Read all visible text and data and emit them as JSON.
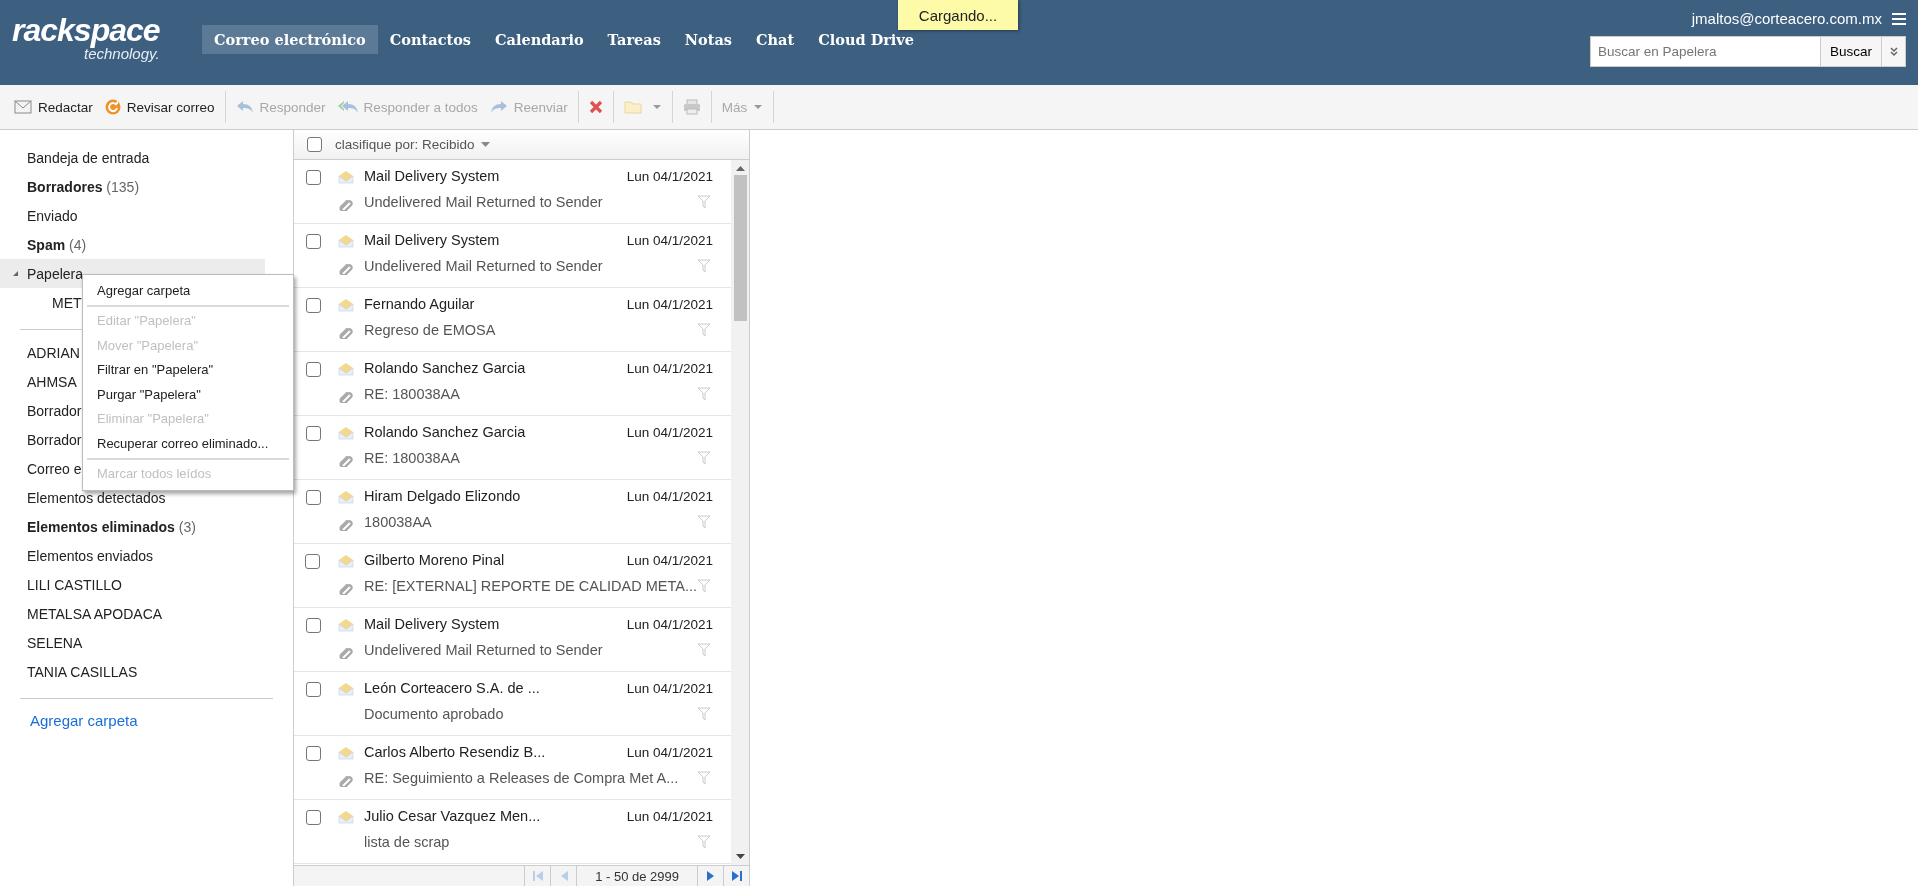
{
  "logo": {
    "brand": "rackspace",
    "tagline": "technology."
  },
  "nav": [
    {
      "label": "Correo electrónico",
      "selected": true
    },
    {
      "label": "Contactos",
      "selected": false
    },
    {
      "label": "Calendario",
      "selected": false
    },
    {
      "label": "Tareas",
      "selected": false
    },
    {
      "label": "Notas",
      "selected": false
    },
    {
      "label": "Chat",
      "selected": false
    },
    {
      "label": "Cloud Drive",
      "selected": false
    }
  ],
  "toast": "Cargando...",
  "user": {
    "email": "jmaltos@corteacero.com.mx"
  },
  "search": {
    "placeholder": "Buscar en Papelera",
    "button": "Buscar"
  },
  "toolbar": [
    [
      {
        "kind": "compose",
        "label": "Redactar",
        "disabled": false
      },
      {
        "kind": "refresh",
        "label": "Revisar correo",
        "disabled": false
      }
    ],
    [
      {
        "kind": "reply",
        "label": "Responder",
        "disabled": true
      },
      {
        "kind": "reply-all",
        "label": "Responder a todos",
        "disabled": true
      },
      {
        "kind": "forward",
        "label": "Reenviar",
        "disabled": true
      }
    ],
    [
      {
        "kind": "delete",
        "disabled": false
      }
    ],
    [
      {
        "kind": "move",
        "disabled": true
      }
    ],
    [
      {
        "kind": "print",
        "disabled": true
      }
    ],
    [
      {
        "kind": "more",
        "label": "Más",
        "disabled": true
      }
    ]
  ],
  "folders": [
    {
      "name": "Bandeja de entrada",
      "unread": false,
      "selected": false
    },
    {
      "name": "Borradores",
      "count": "(135)",
      "unread": true,
      "selected": false
    },
    {
      "name": "Enviado",
      "unread": false,
      "selected": false
    },
    {
      "name": "Spam",
      "count": "(4)",
      "unread": true,
      "selected": false
    },
    {
      "name": "Papelera",
      "unread": false,
      "selected": true,
      "expanded": true,
      "children": [
        {
          "name": "MET",
          "unread": false,
          "selected": false
        }
      ]
    }
  ],
  "other_folders": [
    {
      "name": "ADRIAN",
      "unread": false,
      "selected": false
    },
    {
      "name": "AHMSA",
      "unread": false,
      "selected": false
    },
    {
      "name": "Borrador",
      "unread": false,
      "selected": false
    },
    {
      "name": "Borrador",
      "unread": false,
      "selected": false
    },
    {
      "name": "Correo e",
      "unread": false,
      "selected": false
    },
    {
      "name": "Elementos detectados",
      "unread": false,
      "selected": false
    },
    {
      "name": "Elementos eliminados",
      "count": "(3)",
      "unread": true,
      "selected": false
    },
    {
      "name": "Elementos enviados",
      "unread": false,
      "selected": false
    },
    {
      "name": "LILI CASTILLO",
      "unread": false,
      "selected": false
    },
    {
      "name": "METALSA APODACA",
      "unread": false,
      "selected": false
    },
    {
      "name": "SELENA",
      "unread": false,
      "selected": false
    },
    {
      "name": "TANIA CASILLAS",
      "unread": false,
      "selected": false
    }
  ],
  "add_folder": "Agregar carpeta",
  "context_menu": [
    [
      {
        "label": "Agregar carpeta",
        "disabled": false
      }
    ],
    [
      {
        "label": "Editar \"Papelera\"",
        "disabled": true
      },
      {
        "label": "Mover \"Papelera\"",
        "disabled": true
      },
      {
        "label": "Filtrar en \"Papelera\"",
        "disabled": false
      },
      {
        "label": "Purgar \"Papelera\"",
        "disabled": false
      },
      {
        "label": "Eliminar \"Papelera\"",
        "disabled": true
      },
      {
        "label": "Recuperar correo eliminado...",
        "disabled": false
      }
    ],
    [
      {
        "label": "Marcar todos leídos",
        "disabled": true
      }
    ]
  ],
  "sort": {
    "label": "clasifique por: Recibido",
    "checked": false
  },
  "messages": [
    {
      "sender": "Mail Delivery System",
      "date": "Lun 04/1/2021",
      "subject": "Undelivered Mail Returned to Sender",
      "attachment": true,
      "checked": false
    },
    {
      "sender": "Mail Delivery System",
      "date": "Lun 04/1/2021",
      "subject": "Undelivered Mail Returned to Sender",
      "attachment": true,
      "checked": false
    },
    {
      "sender": "Fernando Aguilar",
      "date": "Lun 04/1/2021",
      "subject": "Regreso de EMOSA",
      "attachment": true,
      "checked": false
    },
    {
      "sender": "Rolando Sanchez Garcia",
      "date": "Lun 04/1/2021",
      "subject": "RE: 180038AA",
      "attachment": true,
      "checked": false
    },
    {
      "sender": "Rolando Sanchez Garcia",
      "date": "Lun 04/1/2021",
      "subject": "RE: 180038AA",
      "attachment": true,
      "checked": false
    },
    {
      "sender": "Hiram Delgado Elizondo",
      "date": "Lun 04/1/2021",
      "subject": "180038AA",
      "attachment": true,
      "checked": false
    },
    {
      "sender": "Gilberto Moreno Pinal",
      "date": "Lun 04/1/2021",
      "subject": "RE: [EXTERNAL] REPORTE DE CALIDAD META...",
      "attachment": true,
      "checked": false
    },
    {
      "sender": "Mail Delivery System",
      "date": "Lun 04/1/2021",
      "subject": "Undelivered Mail Returned to Sender",
      "attachment": true,
      "checked": false
    },
    {
      "sender": "León Corteacero S.A. de ...",
      "date": "Lun 04/1/2021",
      "subject": "Documento aprobado",
      "attachment": false,
      "checked": false
    },
    {
      "sender": "Carlos Alberto Resendiz B...",
      "date": "Lun 04/1/2021",
      "subject": "RE: Seguimiento a Releases de Compra Met A...",
      "attachment": true,
      "checked": false
    },
    {
      "sender": "Julio Cesar Vazquez Men...",
      "date": "Lun 04/1/2021",
      "subject": "lista de scrap",
      "attachment": false,
      "checked": false
    }
  ],
  "pager": {
    "range": "1 - 50 de 2999",
    "buttons": [
      {
        "kind": "first",
        "disabled": true
      },
      {
        "kind": "prev",
        "disabled": true
      },
      {
        "kind": "next",
        "disabled": false
      },
      {
        "kind": "last",
        "disabled": false
      }
    ]
  }
}
